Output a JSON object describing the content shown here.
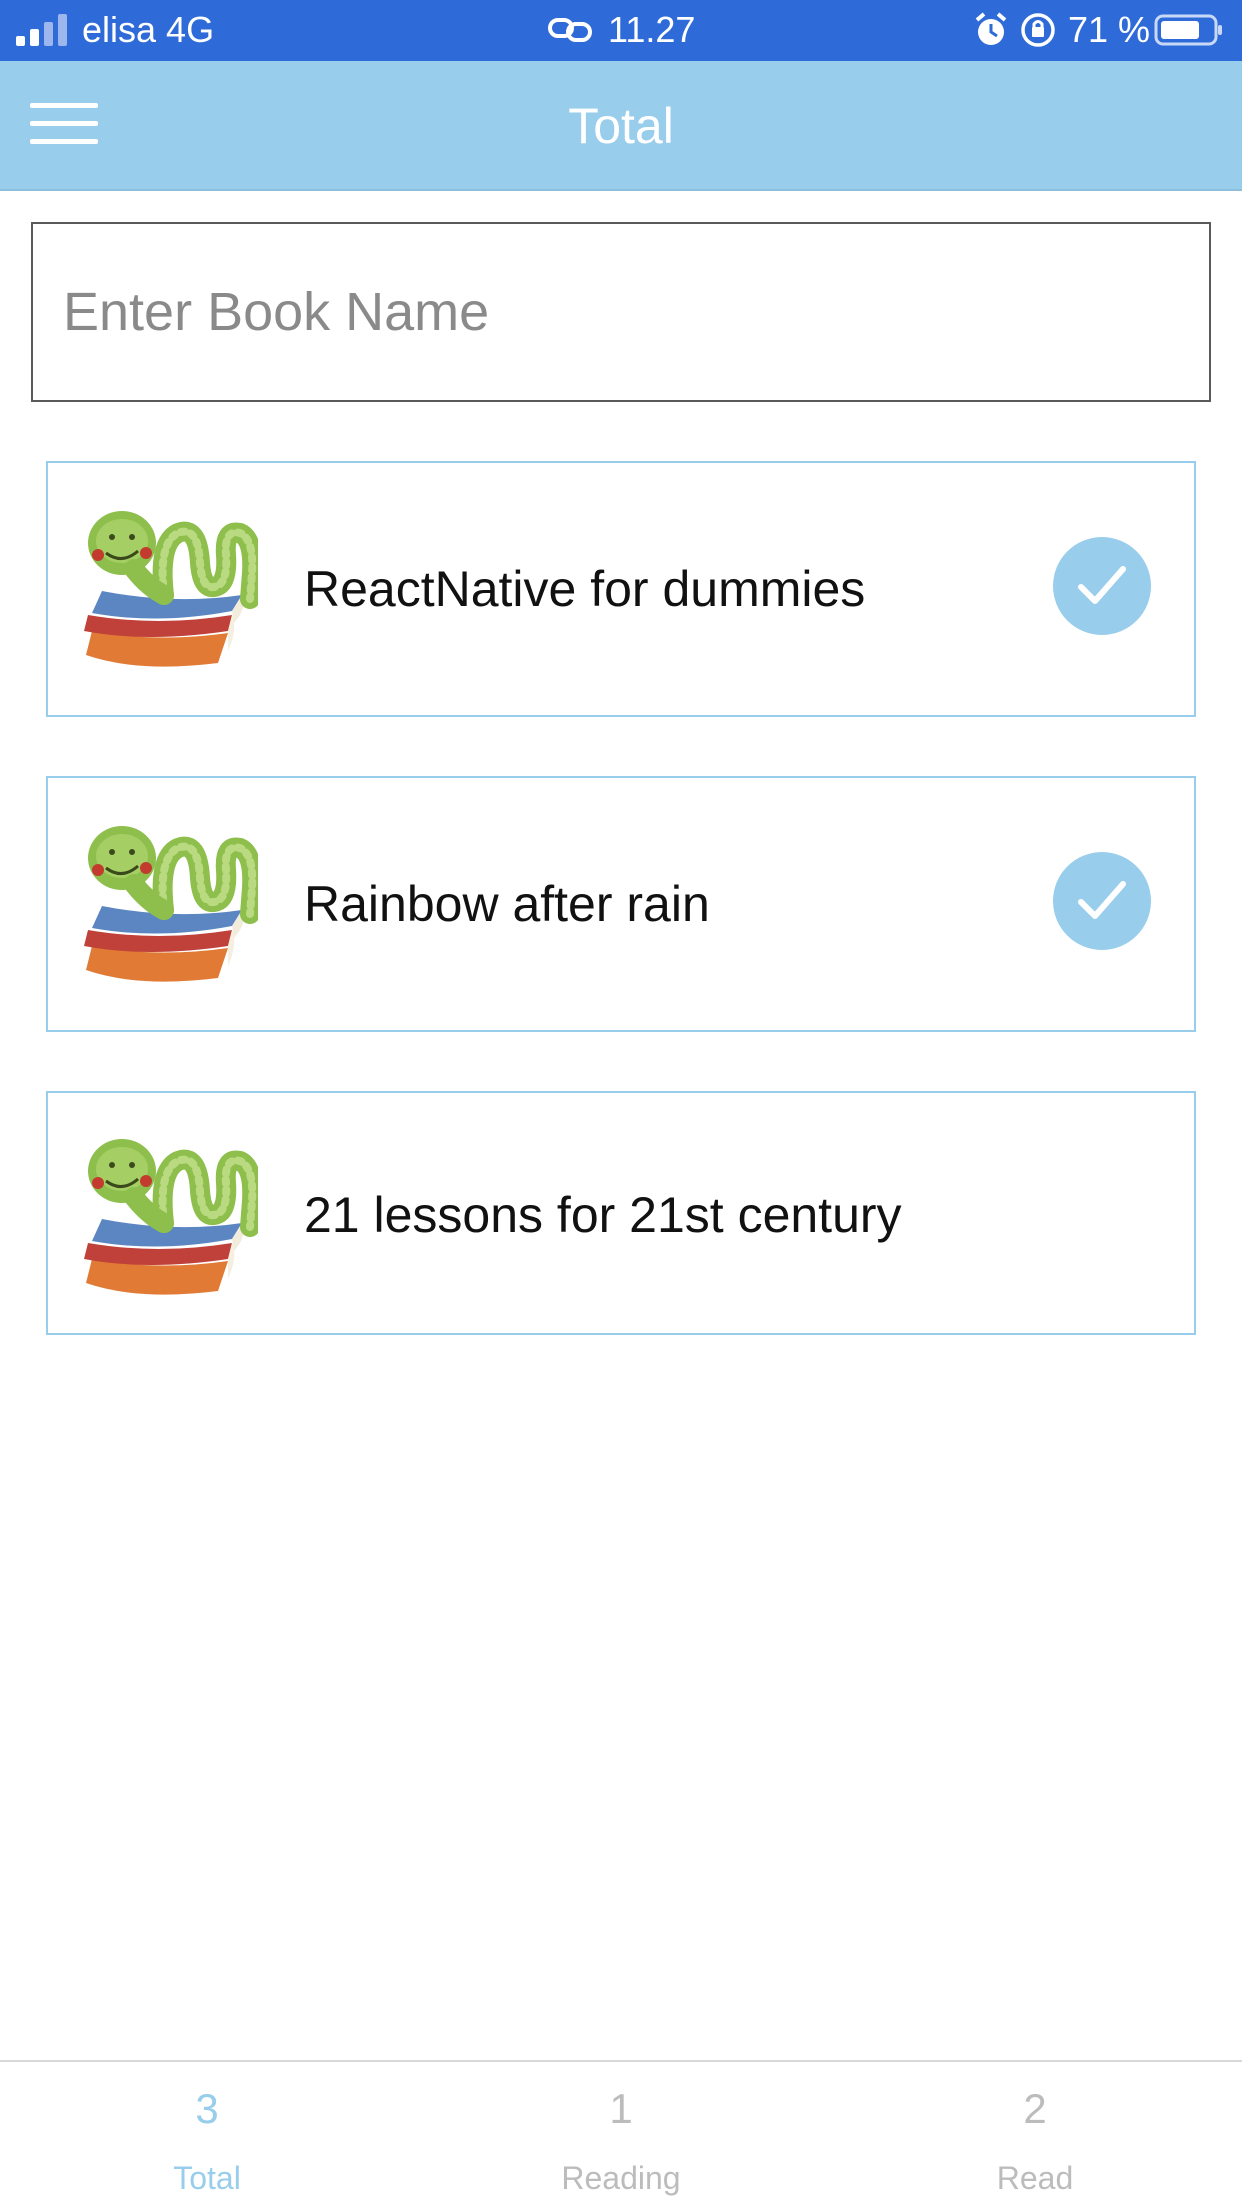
{
  "status_bar": {
    "carrier": "elisa 4G",
    "time": "11.27",
    "battery": "71 %",
    "icons": [
      "signal-icon",
      "link-icon",
      "alarm-icon",
      "orientation-lock-icon",
      "battery-icon"
    ]
  },
  "header": {
    "title": "Total",
    "menu_icon": "hamburger-menu-icon"
  },
  "search": {
    "placeholder": "Enter Book Name",
    "value": ""
  },
  "books": [
    {
      "name": "ReactNative for dummies",
      "checked": true
    },
    {
      "name": "Rainbow after rain",
      "checked": true
    },
    {
      "name": "21 lessons for 21st century",
      "checked": false
    }
  ],
  "tabs": [
    {
      "count": "3",
      "label": "Total",
      "active": true
    },
    {
      "count": "1",
      "label": "Reading",
      "active": false
    },
    {
      "count": "2",
      "label": "Read",
      "active": false
    }
  ],
  "colors": {
    "status_bar": "#2f6bd8",
    "header": "#99cdec",
    "accent": "#99cdec",
    "inactive_tab": "#bcbcbc"
  }
}
